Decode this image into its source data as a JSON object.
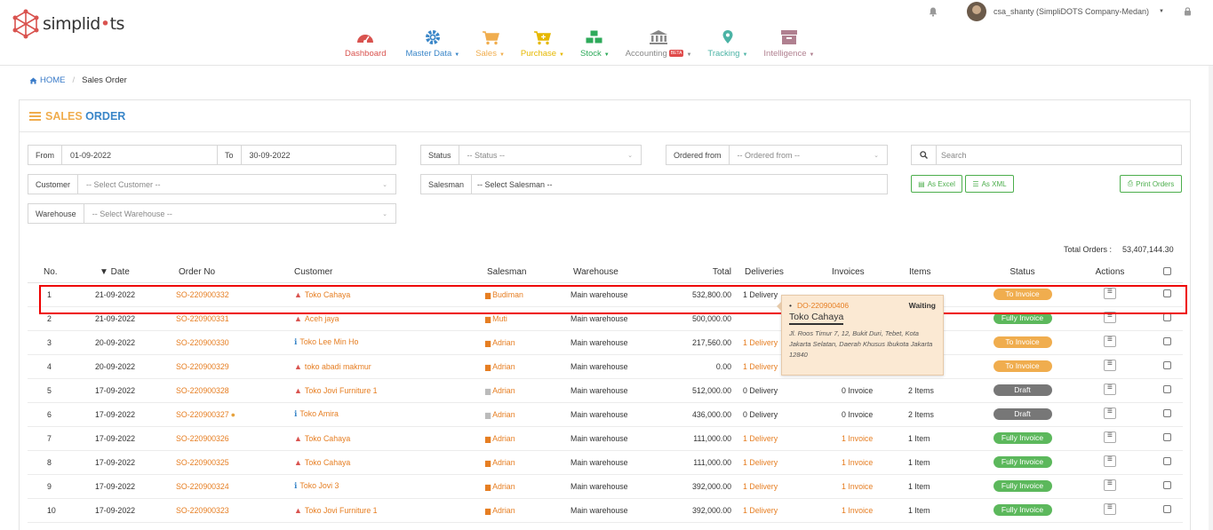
{
  "app": {
    "logo_text_prefix": "simplid",
    "logo_text_suffix": "ts",
    "user": "csa_shanty (SimpliDOTS Company-Medan)"
  },
  "nav": [
    {
      "label": "Dashboard",
      "icon": "dashboard-icon",
      "color": "#d9534f"
    },
    {
      "label": "Master Data",
      "icon": "gear-icon",
      "color": "#3a86c8"
    },
    {
      "label": "Sales",
      "icon": "cart-icon",
      "color": "#f0ad4e"
    },
    {
      "label": "Purchase",
      "icon": "cart-plus-icon",
      "color": "#e6b800"
    },
    {
      "label": "Stock",
      "icon": "cubes-icon",
      "color": "#2eaa5a"
    },
    {
      "label": "Accounting",
      "icon": "bank-icon",
      "color": "#888888",
      "badge": "BETA"
    },
    {
      "label": "Tracking",
      "icon": "map-pin-icon",
      "color": "#4bb3a5"
    },
    {
      "label": "Intelligence",
      "icon": "archive-icon",
      "color": "#b08090"
    }
  ],
  "breadcrumb": {
    "home": "HOME",
    "current": "Sales Order"
  },
  "page": {
    "title_a": "SALES",
    "title_b": "ORDER"
  },
  "filters": {
    "from_label": "From",
    "from_value": "01-09-2022",
    "to_label": "To",
    "to_value": "30-09-2022",
    "status_label": "Status",
    "status_placeholder": "-- Status --",
    "ordered_from_label": "Ordered from",
    "ordered_from_placeholder": "-- Ordered from --",
    "search_placeholder": "Search",
    "customer_label": "Customer",
    "customer_placeholder": "-- Select Customer --",
    "salesman_label": "Salesman",
    "salesman_placeholder": "-- Select Salesman --",
    "warehouse_label": "Warehouse",
    "warehouse_placeholder": "-- Select Warehouse --",
    "excel_label": "As Excel",
    "xml_label": "As XML",
    "print_label": "Print Orders"
  },
  "total": {
    "label": "Total Orders :",
    "value": "53,407,144.30"
  },
  "table": {
    "headers": {
      "no": "No.",
      "date": "▼ Date",
      "order_no": "Order No",
      "customer": "Customer",
      "salesman": "Salesman",
      "warehouse": "Warehouse",
      "total": "Total",
      "deliveries": "Deliveries",
      "invoices": "Invoices",
      "items": "Items",
      "status": "Status",
      "actions": "Actions"
    },
    "rows": [
      {
        "no": "1",
        "date": "21-09-2022",
        "order_no": "SO-220900332",
        "customer": "Toko Cahaya",
        "cust_icon": "warn",
        "salesman": "Budiman",
        "warehouse": "Main warehouse",
        "total": "532,800.00",
        "deliveries": "1 Delivery",
        "deliv_link": false,
        "invoices": "",
        "inv_link": false,
        "items": "",
        "status": "To Invoice",
        "status_type": "invoice"
      },
      {
        "no": "2",
        "date": "21-09-2022",
        "order_no": "SO-220900331",
        "customer": "Aceh jaya",
        "cust_icon": "warn",
        "salesman": "Muti",
        "warehouse": "Main warehouse",
        "total": "500,000.00",
        "deliveries": "",
        "deliv_link": false,
        "invoices": "",
        "inv_link": false,
        "items": "",
        "status": "Fully Invoice",
        "status_type": "fully"
      },
      {
        "no": "3",
        "date": "20-09-2022",
        "order_no": "SO-220900330",
        "customer": "Toko Lee Min Ho",
        "cust_icon": "info",
        "salesman": "Adrian",
        "warehouse": "Main warehouse",
        "total": "217,560.00",
        "deliveries": "1 Delivery",
        "deliv_link": true,
        "invoices": "",
        "inv_link": false,
        "items": "",
        "status": "To Invoice",
        "status_type": "invoice"
      },
      {
        "no": "4",
        "date": "20-09-2022",
        "order_no": "SO-220900329",
        "customer": "toko abadi makmur",
        "cust_icon": "warn",
        "salesman": "Adrian",
        "warehouse": "Main warehouse",
        "total": "0.00",
        "deliveries": "1 Delivery",
        "deliv_link": true,
        "invoices": "",
        "inv_link": false,
        "items": "",
        "status": "To Invoice",
        "status_type": "invoice"
      },
      {
        "no": "5",
        "date": "17-09-2022",
        "order_no": "SO-220900328",
        "customer": "Toko Jovi Furniture 1",
        "cust_icon": "warn",
        "salesman": "Adrian",
        "sm_grey": true,
        "warehouse": "Main warehouse",
        "total": "512,000.00",
        "deliveries": "0 Delivery",
        "deliv_link": false,
        "invoices": "0 Invoice",
        "inv_link": false,
        "items": "2 Items",
        "status": "Draft",
        "status_type": "draft"
      },
      {
        "no": "6",
        "date": "17-09-2022",
        "order_no": "SO-220900327",
        "has_comment": true,
        "customer": "Toko Amira",
        "cust_icon": "info",
        "salesman": "Adrian",
        "sm_grey": true,
        "warehouse": "Main warehouse",
        "total": "436,000.00",
        "deliveries": "0 Delivery",
        "deliv_link": false,
        "invoices": "0 Invoice",
        "inv_link": false,
        "items": "2 Items",
        "status": "Draft",
        "status_type": "draft"
      },
      {
        "no": "7",
        "date": "17-09-2022",
        "order_no": "SO-220900326",
        "customer": "Toko Cahaya",
        "cust_icon": "warn",
        "salesman": "Adrian",
        "warehouse": "Main warehouse",
        "total": "111,000.00",
        "deliveries": "1 Delivery",
        "deliv_link": true,
        "invoices": "1 Invoice",
        "inv_link": true,
        "items": "1 Item",
        "status": "Fully Invoice",
        "status_type": "fully"
      },
      {
        "no": "8",
        "date": "17-09-2022",
        "order_no": "SO-220900325",
        "customer": "Toko Cahaya",
        "cust_icon": "warn",
        "salesman": "Adrian",
        "warehouse": "Main warehouse",
        "total": "111,000.00",
        "deliveries": "1 Delivery",
        "deliv_link": true,
        "invoices": "1 Invoice",
        "inv_link": true,
        "items": "1 Item",
        "status": "Fully Invoice",
        "status_type": "fully"
      },
      {
        "no": "9",
        "date": "17-09-2022",
        "order_no": "SO-220900324",
        "customer": "Toko Jovi 3",
        "cust_icon": "info",
        "salesman": "Adrian",
        "warehouse": "Main warehouse",
        "total": "392,000.00",
        "deliveries": "1 Delivery",
        "deliv_link": true,
        "invoices": "1 Invoice",
        "inv_link": true,
        "items": "1 Item",
        "status": "Fully Invoice",
        "status_type": "fully"
      },
      {
        "no": "10",
        "date": "17-09-2022",
        "order_no": "SO-220900323",
        "customer": "Toko Jovi Furniture 1",
        "cust_icon": "warn",
        "salesman": "Adrian",
        "warehouse": "Main warehouse",
        "total": "392,000.00",
        "deliveries": "1 Delivery",
        "deliv_link": true,
        "invoices": "1 Invoice",
        "inv_link": true,
        "items": "1 Item",
        "status": "Fully Invoice",
        "status_type": "fully"
      }
    ]
  },
  "popup": {
    "delivery_no": "DO-220900406",
    "status": "Waiting",
    "customer": "Toko Cahaya",
    "address": "Jl. Roos Timur 7, 12, Bukit Duri, Tebet, Kota Jakarta Selatan, Daerah Khusus Ibukota Jakarta 12840"
  }
}
